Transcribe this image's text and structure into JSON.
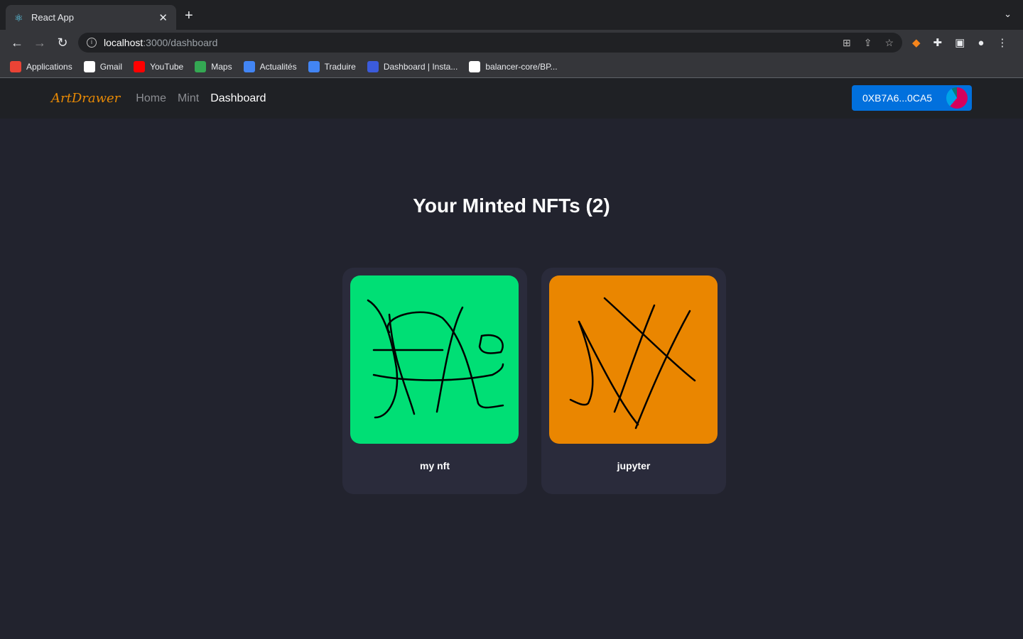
{
  "browser": {
    "tab_title": "React App",
    "url_host": "localhost",
    "url_path": ":3000/dashboard",
    "bookmarks": [
      {
        "label": "Applications",
        "color": "#ea4335"
      },
      {
        "label": "Gmail",
        "color": "#ffffff"
      },
      {
        "label": "YouTube",
        "color": "#ff0000"
      },
      {
        "label": "Maps",
        "color": "#34a853"
      },
      {
        "label": "Actualités",
        "color": "#4285f4"
      },
      {
        "label": "Traduire",
        "color": "#4285f4"
      },
      {
        "label": "Dashboard | Insta...",
        "color": "#3b5bdb"
      },
      {
        "label": "balancer-core/BP...",
        "color": "#ffffff"
      }
    ]
  },
  "navbar": {
    "logo": "ArtDrawer",
    "links": [
      "Home",
      "Mint",
      "Dashboard"
    ],
    "active": "Dashboard",
    "wallet": "0XB7A6...0CA5"
  },
  "main": {
    "title": "Your Minted NFTs (2)",
    "nfts": [
      {
        "name": "my nft",
        "background": "#00df75"
      },
      {
        "name": "jupyter",
        "background": "#ea8600"
      }
    ]
  }
}
